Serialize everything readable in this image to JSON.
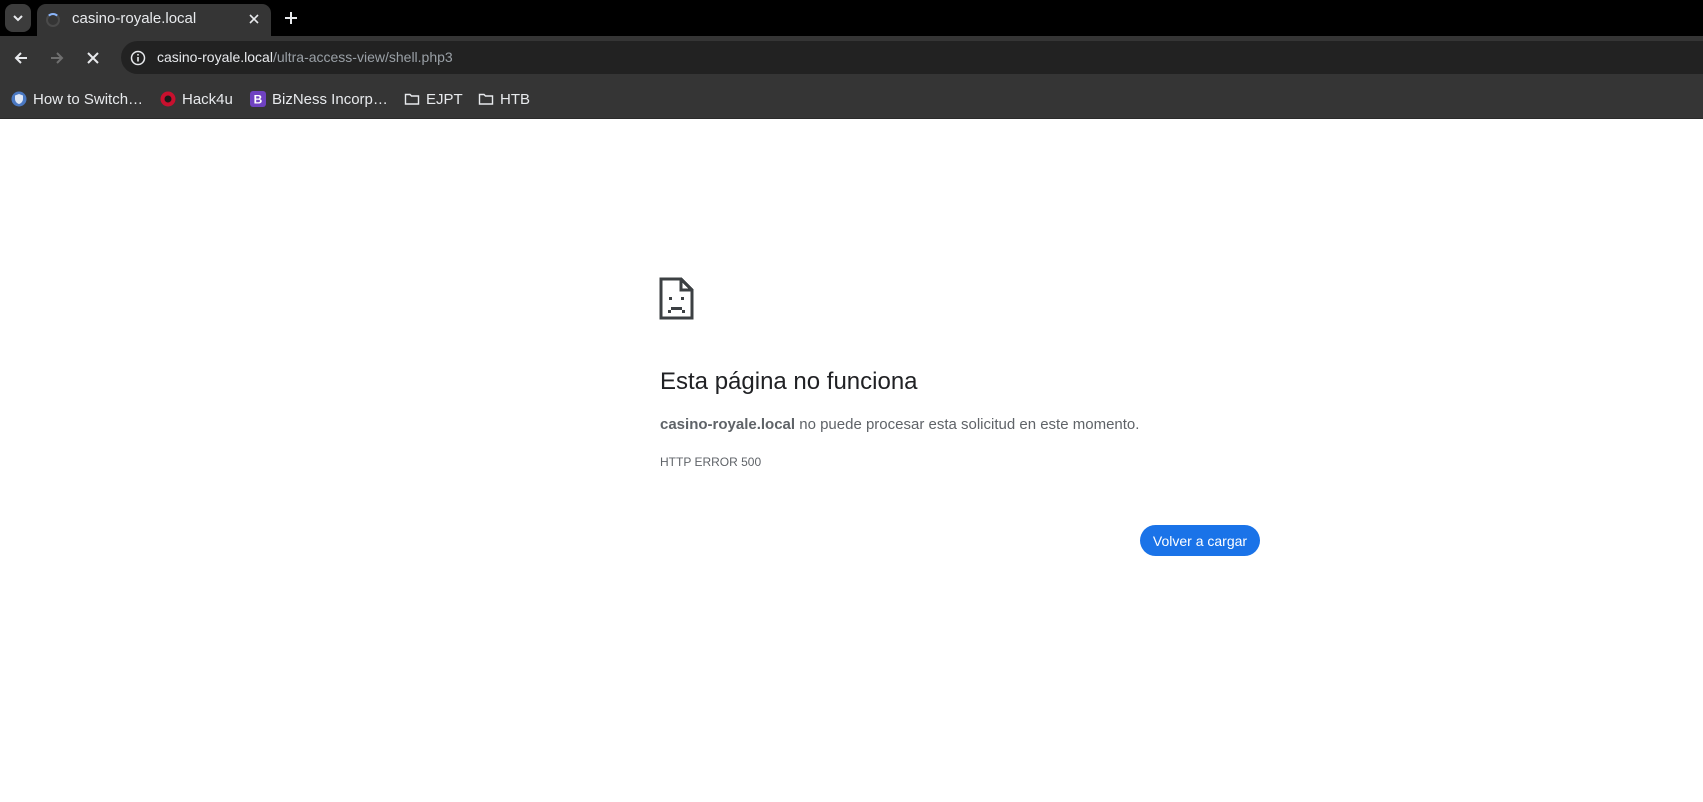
{
  "tabs": [
    {
      "title": "casino-royale.local",
      "loading": true
    }
  ],
  "address_bar": {
    "host": "casino-royale.local",
    "path": "/ultra-access-view/shell.php3"
  },
  "bookmarks": [
    {
      "label": "How to Switch…",
      "icon": "blue-shield-favicon"
    },
    {
      "label": "Hack4u",
      "icon": "red-logo-favicon"
    },
    {
      "label": "BizNess Incorp…",
      "icon": "purple-b-favicon"
    },
    {
      "label": "EJPT",
      "icon": "folder-icon"
    },
    {
      "label": "HTB",
      "icon": "folder-icon"
    }
  ],
  "error_page": {
    "title": "Esta página no funciona",
    "host": "casino-royale.local",
    "description": " no puede procesar esta solicitud en este momento.",
    "error_code": "HTTP ERROR 500",
    "reload_button": "Volver a cargar"
  },
  "colors": {
    "tabstrip_bg": "#000000",
    "toolbar_bg": "#353535",
    "omnibox_bg": "#222222",
    "reload_button_bg": "#1a73e8",
    "title_text": "#202124",
    "secondary_text": "#5f6368"
  }
}
